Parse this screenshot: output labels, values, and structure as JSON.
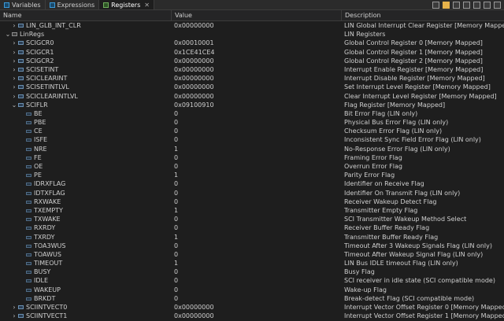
{
  "tabs": [
    {
      "label": "Variables",
      "active": false
    },
    {
      "label": "Expressions",
      "active": false
    },
    {
      "label": "Registers",
      "active": true
    }
  ],
  "columns": {
    "name": "Name",
    "value": "Value",
    "description": "Description"
  },
  "toolbar_icons": [
    "pin-icon",
    "new-group-icon",
    "highlight-icon",
    "collapse-icon",
    "menu-icon",
    "minimize-icon",
    "maximize-icon"
  ],
  "rows": [
    {
      "name": "LIN_GLB_INT_CLR",
      "value": "0x00000000",
      "desc": "LIN Global Interrupt Clear Register [Memory Mapped]",
      "level": 1,
      "expander": "collapsed",
      "kind": "register"
    },
    {
      "name": "LinRegs",
      "value": "",
      "desc": "LIN Registers",
      "level": 0,
      "expander": "expanded",
      "kind": "group"
    },
    {
      "name": "SCIGCR0",
      "value": "0x00010001",
      "desc": "Global Control Register 0 [Memory Mapped]",
      "level": 1,
      "expander": "collapsed",
      "kind": "register"
    },
    {
      "name": "SCIGCR1",
      "value": "0x1CE41CE4",
      "desc": "Global Control Register 1 [Memory Mapped]",
      "level": 1,
      "expander": "collapsed",
      "kind": "register"
    },
    {
      "name": "SCIGCR2",
      "value": "0x00000000",
      "desc": "Global Control Register 2 [Memory Mapped]",
      "level": 1,
      "expander": "collapsed",
      "kind": "register"
    },
    {
      "name": "SCISETINT",
      "value": "0x00000000",
      "desc": "Interrupt Enable Register [Memory Mapped]",
      "level": 1,
      "expander": "collapsed",
      "kind": "register"
    },
    {
      "name": "SCICLEARINT",
      "value": "0x00000000",
      "desc": "Interrupt Disable Register [Memory Mapped]",
      "level": 1,
      "expander": "collapsed",
      "kind": "register"
    },
    {
      "name": "SCISETINTLVL",
      "value": "0x00000000",
      "desc": "Set Interrupt Level Register [Memory Mapped]",
      "level": 1,
      "expander": "collapsed",
      "kind": "register"
    },
    {
      "name": "SCICLEARINTLVL",
      "value": "0x00000000",
      "desc": "Clear Interrupt Level Register [Memory Mapped]",
      "level": 1,
      "expander": "collapsed",
      "kind": "register"
    },
    {
      "name": "SCIFLR",
      "value": "0x09100910",
      "desc": "Flag Register [Memory Mapped]",
      "level": 1,
      "expander": "expanded",
      "kind": "register"
    },
    {
      "name": "BE",
      "value": "0",
      "desc": "Bit Error Flag (LIN only)",
      "level": 2,
      "expander": "none",
      "kind": "field"
    },
    {
      "name": "PBE",
      "value": "0",
      "desc": "Physical Bus Error Flag (LIN only)",
      "level": 2,
      "expander": "none",
      "kind": "field"
    },
    {
      "name": "CE",
      "value": "0",
      "desc": "Checksum Error Flag (LIN only)",
      "level": 2,
      "expander": "none",
      "kind": "field"
    },
    {
      "name": "ISFE",
      "value": "0",
      "desc": "Inconsistent Sync Field Error Flag (LIN only)",
      "level": 2,
      "expander": "none",
      "kind": "field"
    },
    {
      "name": "NRE",
      "value": "1",
      "desc": "No-Response Error Flag (LIN only)",
      "level": 2,
      "expander": "none",
      "kind": "field"
    },
    {
      "name": "FE",
      "value": "0",
      "desc": "Framing Error Flag",
      "level": 2,
      "expander": "none",
      "kind": "field"
    },
    {
      "name": "OE",
      "value": "0",
      "desc": "Overrun Error Flag",
      "level": 2,
      "expander": "none",
      "kind": "field"
    },
    {
      "name": "PE",
      "value": "1",
      "desc": "Parity Error Flag",
      "level": 2,
      "expander": "none",
      "kind": "field"
    },
    {
      "name": "IDRXFLAG",
      "value": "0",
      "desc": "Identifier on Receive Flag",
      "level": 2,
      "expander": "none",
      "kind": "field"
    },
    {
      "name": "IDTXFLAG",
      "value": "0",
      "desc": "Identifier On Transmit Flag (LIN only)",
      "level": 2,
      "expander": "none",
      "kind": "field"
    },
    {
      "name": "RXWAKE",
      "value": "0",
      "desc": "Receiver Wakeup Detect Flag",
      "level": 2,
      "expander": "none",
      "kind": "field"
    },
    {
      "name": "TXEMPTY",
      "value": "1",
      "desc": "Transmitter Empty Flag",
      "level": 2,
      "expander": "none",
      "kind": "field"
    },
    {
      "name": "TXWAKE",
      "value": "0",
      "desc": "SCI Transmitter Wakeup Method Select",
      "level": 2,
      "expander": "none",
      "kind": "field"
    },
    {
      "name": "RXRDY",
      "value": "0",
      "desc": "Receiver Buffer Ready Flag",
      "level": 2,
      "expander": "none",
      "kind": "field"
    },
    {
      "name": "TXRDY",
      "value": "1",
      "desc": "Transmitter Buffer Ready Flag",
      "level": 2,
      "expander": "none",
      "kind": "field"
    },
    {
      "name": "TOA3WUS",
      "value": "0",
      "desc": "Timeout After 3 Wakeup Signals Flag (LIN only)",
      "level": 2,
      "expander": "none",
      "kind": "field"
    },
    {
      "name": "TOAWUS",
      "value": "0",
      "desc": "Timeout After Wakeup Signal Flag (LIN only)",
      "level": 2,
      "expander": "none",
      "kind": "field"
    },
    {
      "name": "TIMEOUT",
      "value": "1",
      "desc": "LIN Bus IDLE timeout Flag (LIN only)",
      "level": 2,
      "expander": "none",
      "kind": "field"
    },
    {
      "name": "BUSY",
      "value": "0",
      "desc": "Busy Flag",
      "level": 2,
      "expander": "none",
      "kind": "field"
    },
    {
      "name": "IDLE",
      "value": "0",
      "desc": "SCI receiver in idle state (SCI compatible mode)",
      "level": 2,
      "expander": "none",
      "kind": "field"
    },
    {
      "name": "WAKEUP",
      "value": "0",
      "desc": "Wake-up Flag",
      "level": 2,
      "expander": "none",
      "kind": "field"
    },
    {
      "name": "BRKDT",
      "value": "0",
      "desc": "Break-detect Flag (SCI compatible mode)",
      "level": 2,
      "expander": "none",
      "kind": "field"
    },
    {
      "name": "SCIINTVECT0",
      "value": "0x00000000",
      "desc": "Interrupt Vector Offset Register 0 [Memory Mapped]",
      "level": 1,
      "expander": "collapsed",
      "kind": "register"
    },
    {
      "name": "SCIINTVECT1",
      "value": "0x00000000",
      "desc": "Interrupt Vector Offset Register 1 [Memory Mapped]",
      "level": 1,
      "expander": "collapsed",
      "kind": "register"
    }
  ]
}
